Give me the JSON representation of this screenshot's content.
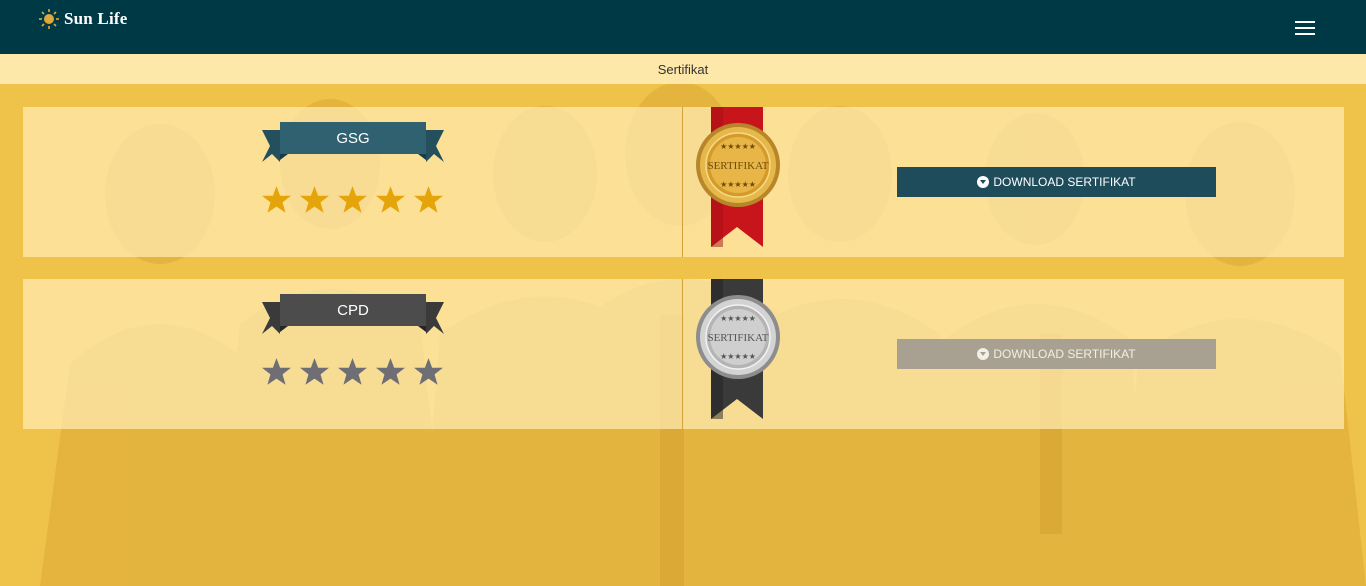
{
  "header": {
    "brand": "Sun Life",
    "menu_icon": "hamburger-icon",
    "bg_color": "#003946"
  },
  "breadcrumb": {
    "title": "Sertifikat"
  },
  "certificates": [
    {
      "name": "GSG",
      "rating": 5,
      "rating_max": 5,
      "star_color": "#e5a50a",
      "ribbon_color": "#2f6170",
      "medal_text": "SERTIFIKAT",
      "medal_style": "gold",
      "button_label": "DOWNLOAD SERTIFIKAT",
      "button_state": "enabled"
    },
    {
      "name": "CPD",
      "rating": 0,
      "rating_max": 5,
      "star_color": "#6e6e74",
      "ribbon_color": "#4a4a4a",
      "medal_text": "SERTIFIKAT",
      "medal_style": "silver",
      "button_label": "DOWNLOAD SERTIFIKAT",
      "button_state": "disabled"
    }
  ]
}
